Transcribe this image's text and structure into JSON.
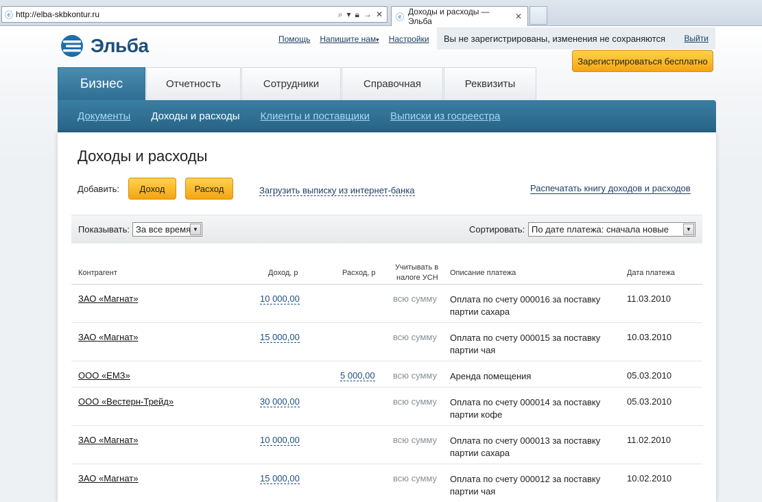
{
  "browser": {
    "url": "http://elba-skbkontur.ru",
    "tab_title": "Доходы и расходы — Эльба"
  },
  "header": {
    "logo_text": "Эльба",
    "links": [
      "Помощь",
      "Напишите нам",
      "Настройки"
    ],
    "notice": "Вы не зарегистрированы, изменения не сохраняются",
    "exit": "Выйти",
    "register_button": "Зарегистрироваться бесплатно"
  },
  "main_tabs": [
    "Бизнес",
    "Отчетность",
    "Сотрудники",
    "Справочная",
    "Реквизиты"
  ],
  "sub_nav": [
    "Документы",
    "Доходы и расходы",
    "Клиенты и поставщики",
    "Выписки из госреестра"
  ],
  "content": {
    "title": "Доходы и расходы",
    "add_label": "Добавить:",
    "income_button": "Доход",
    "expense_button": "Расход",
    "upload_link": "Загрузить выписку из интернет-банка",
    "print_link": "Распечатать книгу доходов и расходов",
    "show_label": "Показывать:",
    "show_value": "За все время",
    "sort_label": "Сортировать:",
    "sort_value": "По дате платежа: сначала новые"
  },
  "table": {
    "headers": {
      "counterparty": "Контрагент",
      "income": "Доход, р",
      "expense": "Расход, р",
      "usn_line1": "Учитывать в",
      "usn_line2": "налоге УСН",
      "description": "Описание платежа",
      "date": "Дата платежа"
    },
    "rows": [
      {
        "counterparty": "ЗАО «Магнат»",
        "income": "10 000,00",
        "expense": "",
        "usn": "всю сумму",
        "desc1": "Оплата по счету 000016 за поставку",
        "desc2": "партии сахара",
        "date": "11.03.2010"
      },
      {
        "counterparty": "ЗАО «Магнат»",
        "income": "15 000,00",
        "expense": "",
        "usn": "всю сумму",
        "desc1": "Оплата по счету 000015 за поставку",
        "desc2": "партии чая",
        "date": "10.03.2010"
      },
      {
        "counterparty": "ООО «ЕМЗ»",
        "income": "",
        "expense": "5 000,00",
        "usn": "всю сумму",
        "desc1": "Аренда помещения",
        "desc2": "",
        "date": "05.03.2010"
      },
      {
        "counterparty": "ООО «Вестерн-Трейд»",
        "income": "30 000,00",
        "expense": "",
        "usn": "всю сумму",
        "desc1": "Оплата по счету 000014 за поставку",
        "desc2": "партии кофе",
        "date": "05.03.2010"
      },
      {
        "counterparty": "ЗАО «Магнат»",
        "income": "10 000,00",
        "expense": "",
        "usn": "всю сумму",
        "desc1": "Оплата по счету 000013 за поставку",
        "desc2": "партии сахара",
        "date": "11.02.2010"
      },
      {
        "counterparty": "ЗАО «Магнат»",
        "income": "15 000,00",
        "expense": "",
        "usn": "всю сумму",
        "desc1": "Оплата по счету 000012 за поставку",
        "desc2": "партии чая",
        "date": "10.02.2010"
      }
    ]
  }
}
